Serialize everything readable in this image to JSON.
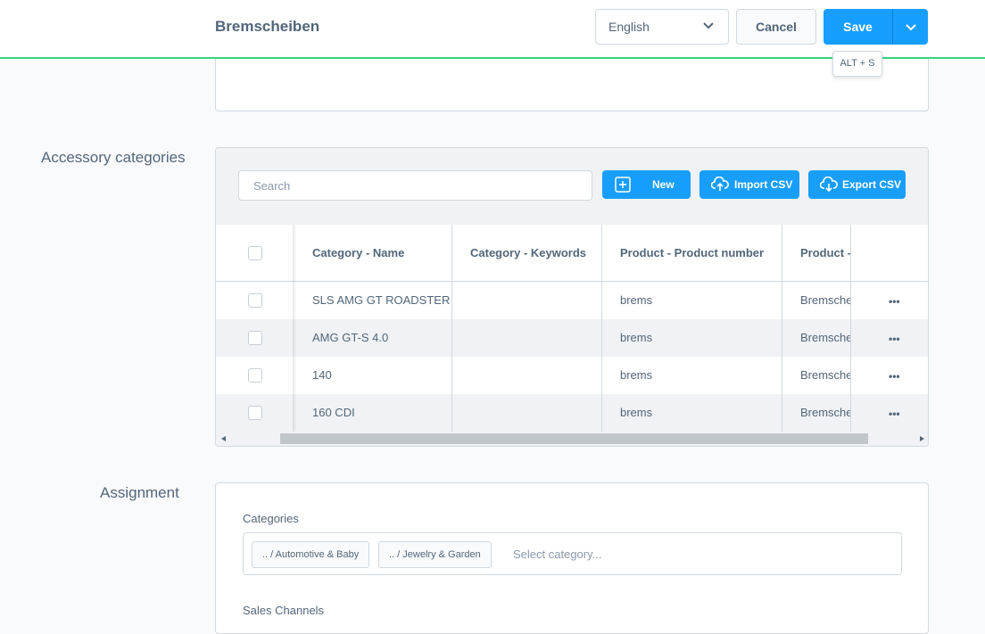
{
  "header": {
    "title": "Bremscheiben",
    "language": "English",
    "cancel_label": "Cancel",
    "save_label": "Save",
    "save_tooltip": "ALT + S",
    "accent_color": "#189eff",
    "border_accent_color": "#37d483"
  },
  "accessory": {
    "section_label": "Accessory categories",
    "search_placeholder": "Search",
    "new_label": "New",
    "import_label": "Import CSV",
    "export_label": "Export CSV",
    "columns": [
      "Category - Name",
      "Category - Keywords",
      "Product - Product number",
      "Product -"
    ],
    "rows": [
      {
        "name": "SLS AMG GT ROADSTER",
        "keywords": "",
        "product_number": "brems",
        "product_name": "Bremscheiben"
      },
      {
        "name": "AMG GT-S 4.0",
        "keywords": "",
        "product_number": "brems",
        "product_name": "Bremscheiben"
      },
      {
        "name": "140",
        "keywords": "",
        "product_number": "brems",
        "product_name": "Bremscheiben"
      },
      {
        "name": "160 CDI",
        "keywords": "",
        "product_number": "brems",
        "product_name": "Bremscheiben"
      }
    ],
    "row_actions": "•••"
  },
  "assignment": {
    "section_label": "Assignment",
    "categories_label": "Categories",
    "chips": [
      ".. / Automotive & Baby",
      ".. / Jewelry & Garden"
    ],
    "category_placeholder": "Select category...",
    "sales_channels_label": "Sales Channels"
  }
}
